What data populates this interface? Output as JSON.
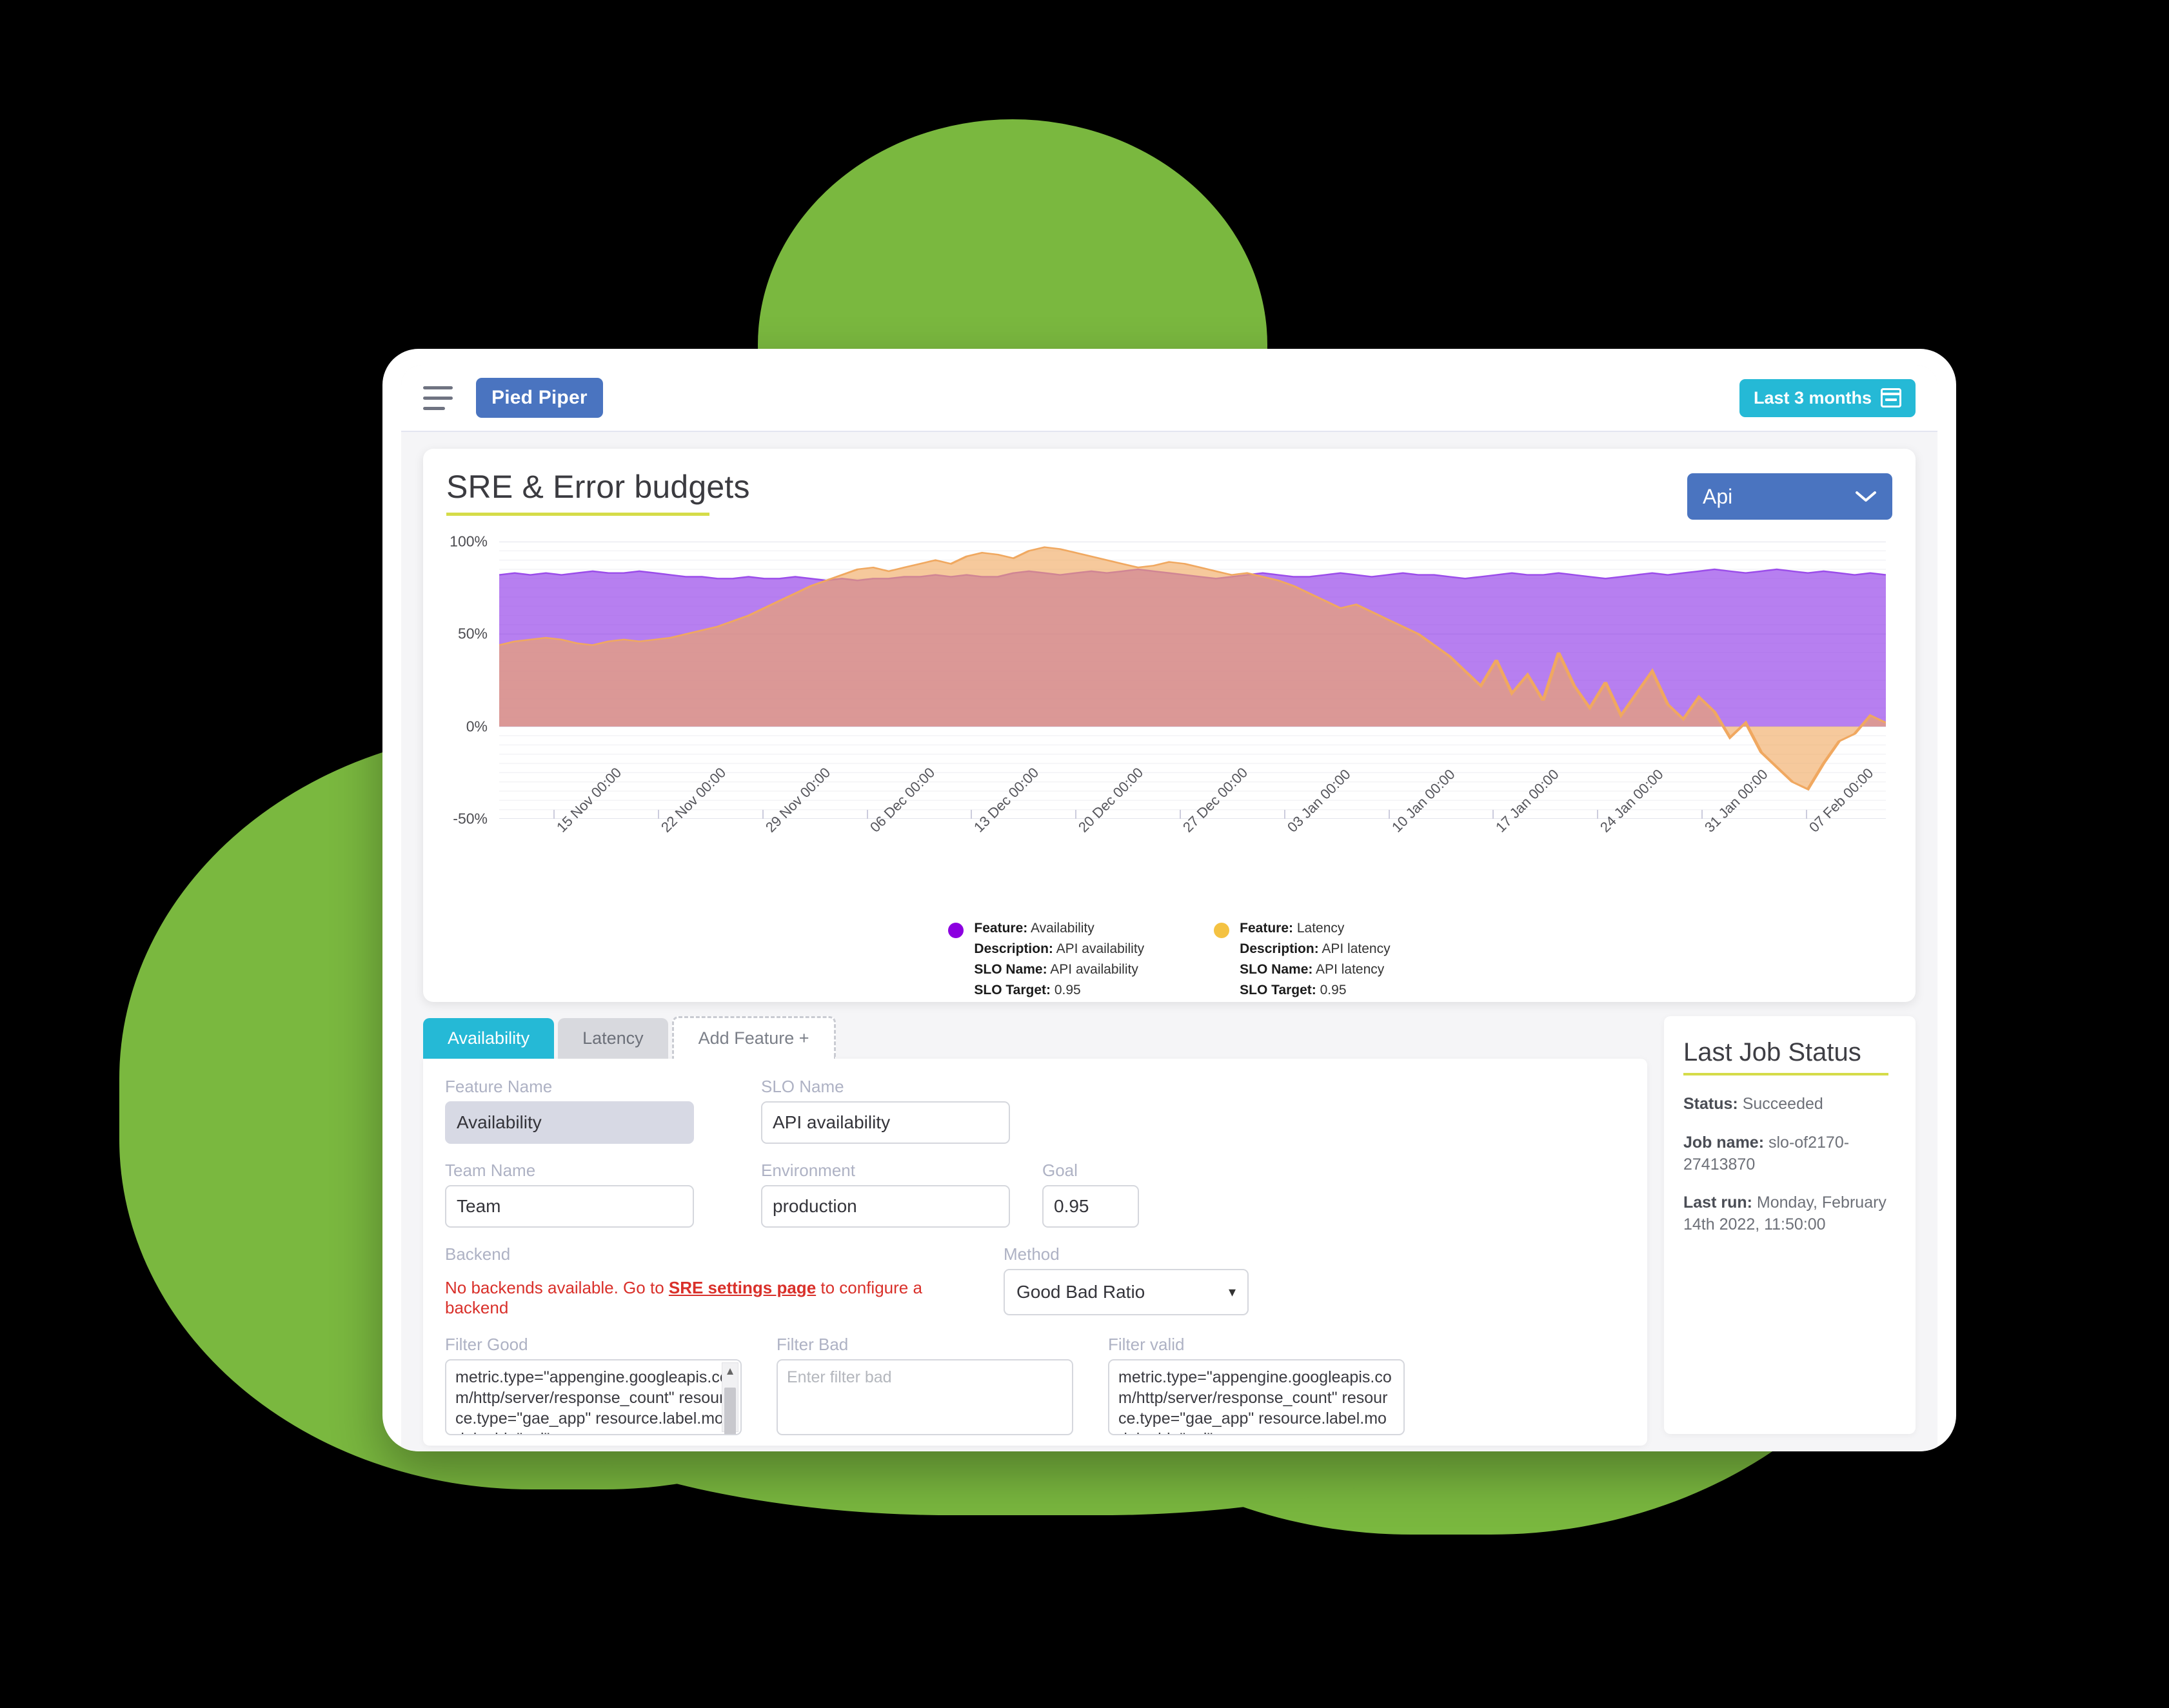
{
  "navbar": {
    "menu_icon": "hamburger-icon",
    "brand": "Pied Piper",
    "range_label": "Last 3 months",
    "range_icon": "calendar-icon"
  },
  "chart_card": {
    "title": "SRE & Error budgets",
    "selector_value": "Api",
    "selector_icon": "chevron-down-icon"
  },
  "legend": [
    {
      "color": "#8c00e0",
      "feature_label": "Feature:",
      "feature": "Availability",
      "description_label": "Description:",
      "description": "API availability",
      "slo_name_label": "SLO Name:",
      "slo_name": "API availability",
      "slo_target_label": "SLO Target:",
      "slo_target": "0.95"
    },
    {
      "color": "#f4c242",
      "feature_label": "Feature:",
      "feature": "Latency",
      "description_label": "Description:",
      "description": "API latency",
      "slo_name_label": "SLO Name:",
      "slo_name": "API latency",
      "slo_target_label": "SLO Target:",
      "slo_target": "0.95"
    }
  ],
  "tabs": [
    {
      "label": "Availability",
      "state": "active"
    },
    {
      "label": "Latency",
      "state": "inactive"
    },
    {
      "label": "Add Feature +",
      "state": "add"
    }
  ],
  "form": {
    "feature_name_label": "Feature Name",
    "feature_name_value": "Availability",
    "slo_name_label": "SLO Name",
    "slo_name_value": "API availability",
    "team_name_label": "Team Name",
    "team_name_value": "Team",
    "environment_label": "Environment",
    "environment_value": "production",
    "goal_label": "Goal",
    "goal_value": "0.95",
    "backend_label": "Backend",
    "backend_error_pre": "No backends available. Go to ",
    "backend_error_link": "SRE settings page",
    "backend_error_post": " to configure a backend",
    "method_label": "Method",
    "method_value": "Good Bad Ratio",
    "filter_good_label": "Filter Good",
    "filter_good_value": "metric.type=\"appengine.googleapis.com/http/server/response_count\" resource.type=\"gae_app\" resource.label.module_id=\"api\"",
    "filter_bad_label": "Filter Bad",
    "filter_bad_placeholder": "Enter filter bad",
    "filter_valid_label": "Filter valid",
    "filter_valid_value": "metric.type=\"appengine.googleapis.com/http/server/response_count\" resource.type=\"gae_app\" resource.label.module_id=\"api\""
  },
  "status_panel": {
    "title": "Last Job Status",
    "status_label": "Status:",
    "status_value": "Succeeded",
    "job_name_label": "Job name:",
    "job_name_value": "slo-of2170-27413870",
    "last_run_label": "Last run:",
    "last_run_value": "Monday, February 14th 2022, 11:50:00"
  },
  "chart_data": {
    "type": "area",
    "title": "SRE & Error budgets",
    "xlabel": "",
    "ylabel": "",
    "ylim": [
      -50,
      100
    ],
    "yticks": [
      "100%",
      "50%",
      "0%",
      "-50%"
    ],
    "ytick_values": [
      100,
      50,
      0,
      -50
    ],
    "grid": true,
    "legend_position": "bottom-center",
    "xtick_labels": [
      "15 Nov 00:00",
      "22 Nov 00:00",
      "29 Nov 00:00",
      "06 Dec 00:00",
      "13 Dec 00:00",
      "20 Dec 00:00",
      "27 Dec 00:00",
      "03 Jan 00:00",
      "10 Jan 00:00",
      "17 Jan 00:00",
      "24 Jan 00:00",
      "31 Jan 00:00",
      "07 Feb 00:00"
    ],
    "series": [
      {
        "name": "Availability",
        "color": "#9b4dea",
        "fill_opacity": 0.72,
        "values": [
          82,
          83,
          82,
          83,
          82,
          83,
          84,
          83,
          83,
          84,
          83,
          82,
          81,
          81,
          80,
          80,
          81,
          80,
          80,
          81,
          80,
          79,
          80,
          79,
          80,
          80,
          81,
          81,
          82,
          81,
          82,
          81,
          81,
          83,
          84,
          83,
          82,
          83,
          84,
          83,
          84,
          85,
          84,
          83,
          82,
          81,
          80,
          81,
          82,
          83,
          82,
          81,
          81,
          82,
          83,
          82,
          81,
          82,
          83,
          82,
          82,
          81,
          80,
          81,
          82,
          83,
          82,
          82,
          83,
          82,
          81,
          80,
          81,
          82,
          83,
          82,
          83,
          84,
          85,
          84,
          83,
          84,
          85,
          84,
          83,
          84,
          83,
          82,
          83,
          82
        ]
      },
      {
        "name": "Latency",
        "color": "#f0a860",
        "fill_opacity": 0.62,
        "values": [
          44,
          46,
          47,
          48,
          47,
          45,
          44,
          46,
          47,
          46,
          47,
          48,
          50,
          52,
          54,
          57,
          60,
          64,
          68,
          72,
          76,
          79,
          82,
          85,
          86,
          84,
          86,
          88,
          90,
          88,
          92,
          94,
          93,
          91,
          95,
          97,
          96,
          94,
          92,
          90,
          88,
          86,
          87,
          89,
          88,
          86,
          84,
          82,
          83,
          81,
          79,
          76,
          72,
          68,
          64,
          66,
          62,
          58,
          54,
          50,
          44,
          38,
          30,
          22,
          36,
          18,
          28,
          14,
          40,
          22,
          10,
          24,
          6,
          18,
          30,
          12,
          4,
          16,
          8,
          -6,
          2,
          -14,
          -22,
          -30,
          -34,
          -20,
          -8,
          -4,
          6,
          2
        ]
      }
    ]
  }
}
